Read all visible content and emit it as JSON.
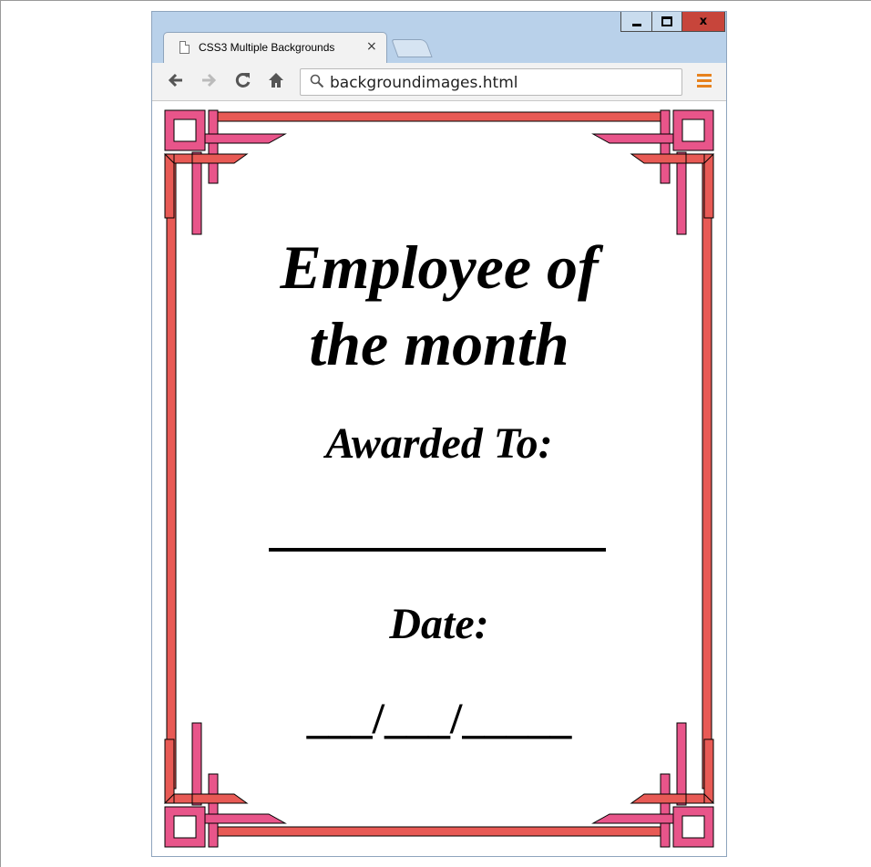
{
  "window": {
    "controls": {
      "minimize": "minimize",
      "maximize": "maximize",
      "close": "x"
    }
  },
  "tab": {
    "title": "CSS3 Multiple Backgrounds",
    "close_label": "×"
  },
  "toolbar": {
    "back_icon": "arrow-left-icon",
    "forward_icon": "arrow-right-icon",
    "reload_icon": "reload-icon",
    "home_icon": "home-icon",
    "url": "backgroundimages.html",
    "menu_icon": "hamburger-menu-icon",
    "menu_color": "#e7821e"
  },
  "certificate": {
    "title_line1": "Employee of",
    "title_line2": "the month",
    "awarded_label": "Awarded To:",
    "date_label": "Date:",
    "date_blanks": "___/___/_____",
    "border_color": "#e85a55",
    "accent_color": "#e8558a"
  }
}
